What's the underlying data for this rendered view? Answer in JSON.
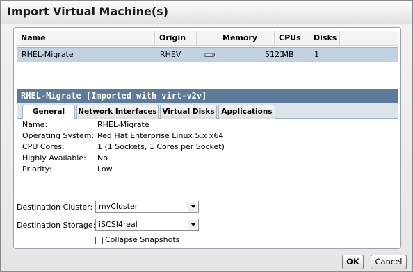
{
  "dialog": {
    "title": "Import Virtual Machine(s)"
  },
  "grid": {
    "columns": [
      "Name",
      "Origin",
      "Memory",
      "CPUs",
      "Disks"
    ],
    "rows": [
      {
        "name": "RHEL-Migrate",
        "origin": "RHEV",
        "memory": "512 MB",
        "cpus": "1",
        "disks": "1"
      }
    ]
  },
  "details": {
    "header": "RHEL-Migrate [Imported with virt-v2v]",
    "tabs": [
      "General",
      "Network Interfaces",
      "Virtual Disks",
      "Applications"
    ],
    "active_tab": "General",
    "properties": [
      {
        "label": "Name:",
        "value": "RHEL-Migrate"
      },
      {
        "label": "Operating System:",
        "value": "Red Hat Enterprise Linux 5.x x64"
      },
      {
        "label": "CPU Cores:",
        "value": "1 (1 Sockets, 1 Cores per Socket)"
      },
      {
        "label": "Highly Available:",
        "value": "No"
      },
      {
        "label": "Priority:",
        "value": "Low"
      }
    ]
  },
  "form": {
    "destination_cluster": {
      "label": "Destination Cluster:",
      "value": "myCluster"
    },
    "destination_storage": {
      "label": "Destination Storage:",
      "value": "iSCSI4real"
    },
    "collapse_snapshots": {
      "label": "Collapse Snapshots",
      "checked": false
    }
  },
  "buttons": {
    "ok": "OK",
    "cancel": "Cancel"
  },
  "icons": {
    "disk": "disk-icon",
    "dropdown": "chevron-down-icon"
  },
  "colors": {
    "selected_row": "#c3d2e1",
    "detail_header": "#5d7a98"
  }
}
